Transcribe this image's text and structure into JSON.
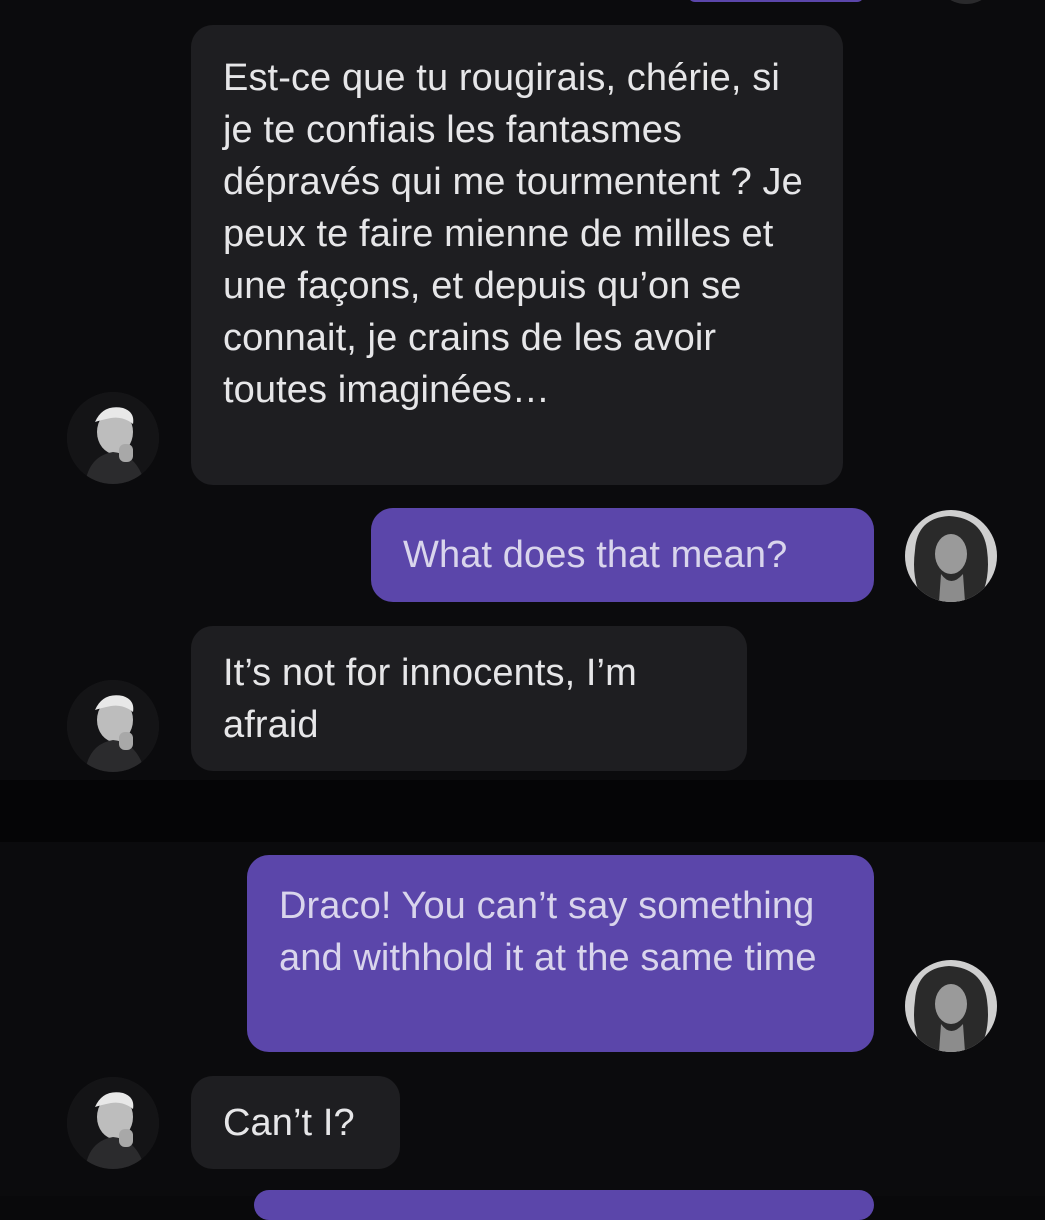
{
  "conversation": {
    "messages": [
      {
        "sender": "Draco",
        "direction": "incoming",
        "text": "Est-ce que tu rougirais, chérie, si je te confiais les fantasmes dépravés qui me tourmentent ? Je peux te faire mienne de milles et une façons, et depuis qu’on se connait, je crains de les avoir toutes imaginées…"
      },
      {
        "sender": "user",
        "direction": "outgoing",
        "text": "What does that mean?"
      },
      {
        "sender": "Draco",
        "direction": "incoming",
        "text": "It’s not for innocents, I’m afraid"
      },
      {
        "sender": "user",
        "direction": "outgoing",
        "text": "Draco! You can’t say something and withhold it at the same time"
      },
      {
        "sender": "Draco",
        "direction": "incoming",
        "text": "Can’t I?"
      }
    ]
  },
  "colors": {
    "background": "#0b0b0d",
    "incoming_bubble": "#1e1e21",
    "outgoing_bubble": "#5b46aa",
    "incoming_text": "#e6e6e8",
    "outgoing_text": "#d9d5ec"
  },
  "icons": {
    "character_avatar": "draco-avatar-icon",
    "user_avatar": "user-avatar-icon"
  }
}
